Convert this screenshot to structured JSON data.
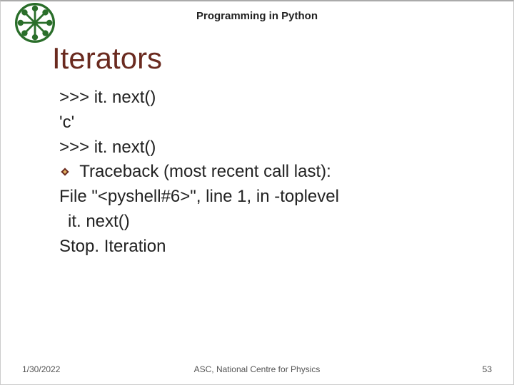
{
  "header": {
    "title": "Programming in Python"
  },
  "title": "Iterators",
  "lines": {
    "l1": ">>> it. next()",
    "l2": "'c'",
    "l3": ">>> it. next()",
    "l4": "Traceback (most recent call last):",
    "l5": "File \"<pyshell#6>\", line 1, in -toplevel",
    "l6": "it. next()",
    "l7": "Stop. Iteration"
  },
  "footer": {
    "date": "1/30/2022",
    "center": "ASC, National Centre for Physics",
    "page": "53"
  }
}
